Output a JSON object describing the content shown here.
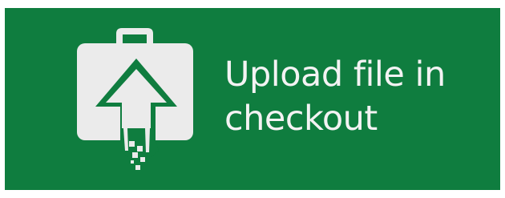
{
  "banner": {
    "background_color": "#0f7d3f",
    "text_color": "#f3f3f3",
    "icon_color": "#ebebeb",
    "title_line1": "Upload file in",
    "title_line2": "checkout",
    "icon": "briefcase-upload-arrow-icon"
  }
}
